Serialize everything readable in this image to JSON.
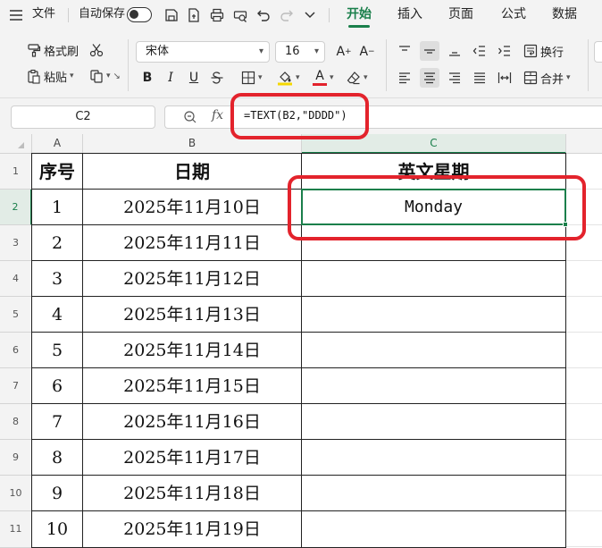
{
  "menubar": {
    "file_label": "文件",
    "autosave_label": "自动保存",
    "tabs": [
      "开始",
      "插入",
      "页面",
      "公式",
      "数据"
    ],
    "active_tab": "开始"
  },
  "ribbon": {
    "format_painter": "格式刷",
    "paste": "粘贴",
    "font_name": "宋体",
    "font_size": "16",
    "wrap_text": "换行",
    "merge": "合并",
    "bold": "B",
    "italic": "I",
    "underline": "U",
    "font_color_letter": "A",
    "increase_font_letter": "A",
    "decrease_font_letter": "A"
  },
  "formula_bar": {
    "name_box": "C2",
    "fx_label": "fx",
    "formula": "=TEXT(B2,\"DDDD\")"
  },
  "columns": [
    "A",
    "B",
    "C"
  ],
  "rows": [
    "1",
    "2",
    "3",
    "4",
    "5",
    "6",
    "7",
    "8",
    "9",
    "10",
    "11"
  ],
  "sheet": {
    "header": [
      "序号",
      "日期",
      "英文星期"
    ],
    "data": [
      [
        "1",
        "2025年11月10日",
        "Monday"
      ],
      [
        "2",
        "2025年11月11日",
        ""
      ],
      [
        "3",
        "2025年11月12日",
        ""
      ],
      [
        "4",
        "2025年11月13日",
        ""
      ],
      [
        "5",
        "2025年11月14日",
        ""
      ],
      [
        "6",
        "2025年11月15日",
        ""
      ],
      [
        "7",
        "2025年11月16日",
        ""
      ],
      [
        "8",
        "2025年11月17日",
        ""
      ],
      [
        "9",
        "2025年11月18日",
        ""
      ],
      [
        "10",
        "2025年11月19日",
        ""
      ]
    ]
  },
  "colors": {
    "accent": "#1a7f4b",
    "annotation": "#e3232c",
    "font_color_bar": "#e3232c",
    "fill_color_bar": "#f5d800"
  }
}
